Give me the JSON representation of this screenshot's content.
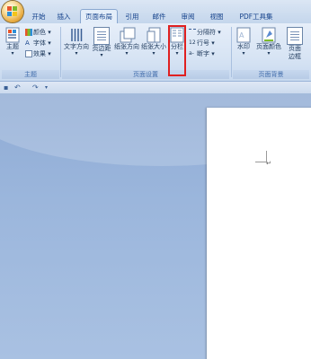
{
  "tabs": [
    {
      "label": "开始"
    },
    {
      "label": "插入"
    },
    {
      "label": "页面布局",
      "active": true
    },
    {
      "label": "引用"
    },
    {
      "label": "邮件"
    },
    {
      "label": "审阅"
    },
    {
      "label": "视图"
    },
    {
      "label": "PDF工具集"
    }
  ],
  "ribbon": {
    "themes_group": {
      "label": "主题",
      "themes_button": "主题",
      "colors": "颜色",
      "fonts": "字体",
      "effects": "效果"
    },
    "page_setup_group": {
      "label": "页面设置",
      "text_direction": "文字方向",
      "margins": "页边距",
      "orientation": "纸张方向",
      "size": "纸张大小",
      "columns": "分栏",
      "breaks": "分隔符",
      "line_numbers": "行号",
      "hyphenation": "断字"
    },
    "page_background_group": {
      "label": "页面背景",
      "watermark": "水印",
      "page_color": "页面颜色",
      "page_borders_line1": "页面",
      "page_borders_line2": "边框"
    }
  },
  "colors": {
    "highlight": "#e02020",
    "tab_text": "#15428b",
    "ribbon_text": "#1e395b"
  }
}
